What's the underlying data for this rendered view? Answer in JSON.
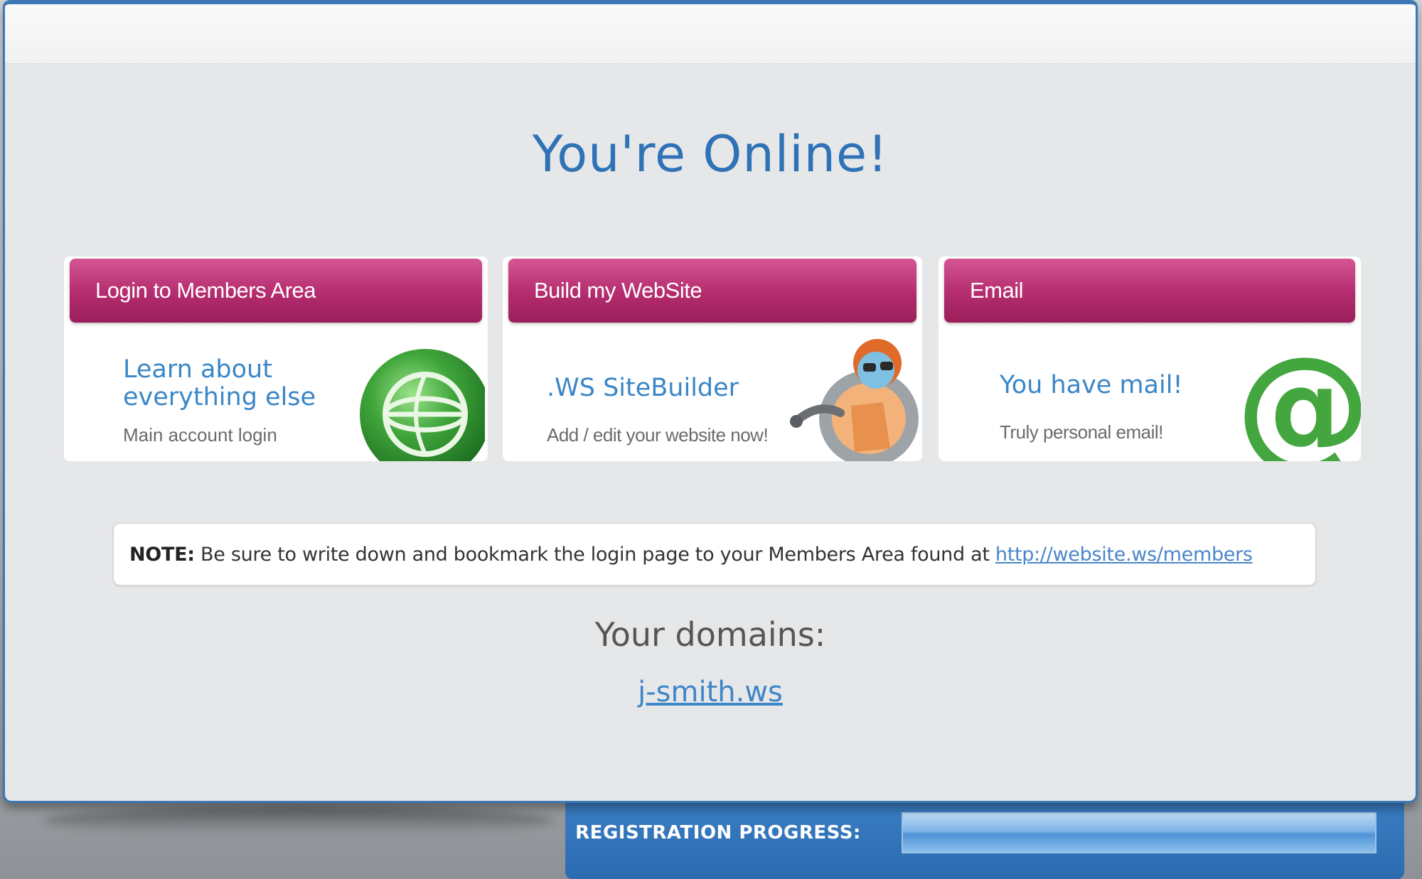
{
  "title": "You're Online!",
  "boxes": [
    {
      "header": "Login to Members Area",
      "headline_line1": "Learn about",
      "headline_line2": "everything else",
      "subtext": "Main account login",
      "icon": "globe-icon"
    },
    {
      "header": "Build my WebSite",
      "headline": ".WS SiteBuilder",
      "subtext": "Add / edit your website now!",
      "icon": "robot-mascot-icon"
    },
    {
      "header": "Email",
      "headline": "You have mail!",
      "subtext": "Truly personal email!",
      "icon": "at-sign-icon"
    }
  ],
  "note": {
    "label": "NOTE:",
    "text": " Be sure to write down and bookmark the login page to your Members Area found at ",
    "link": "http://website.ws/members"
  },
  "domains": {
    "heading": "Your domains:",
    "items": [
      "j-smith.ws"
    ]
  },
  "progress": {
    "label": "REGISTRATION PROGRESS:",
    "fraction": 1.0
  },
  "colors": {
    "accent_blue": "#2f72b5",
    "header_magenta": "#b42c6e",
    "icon_green": "#3fa53a",
    "progress_blue": "#3b7fc4"
  }
}
